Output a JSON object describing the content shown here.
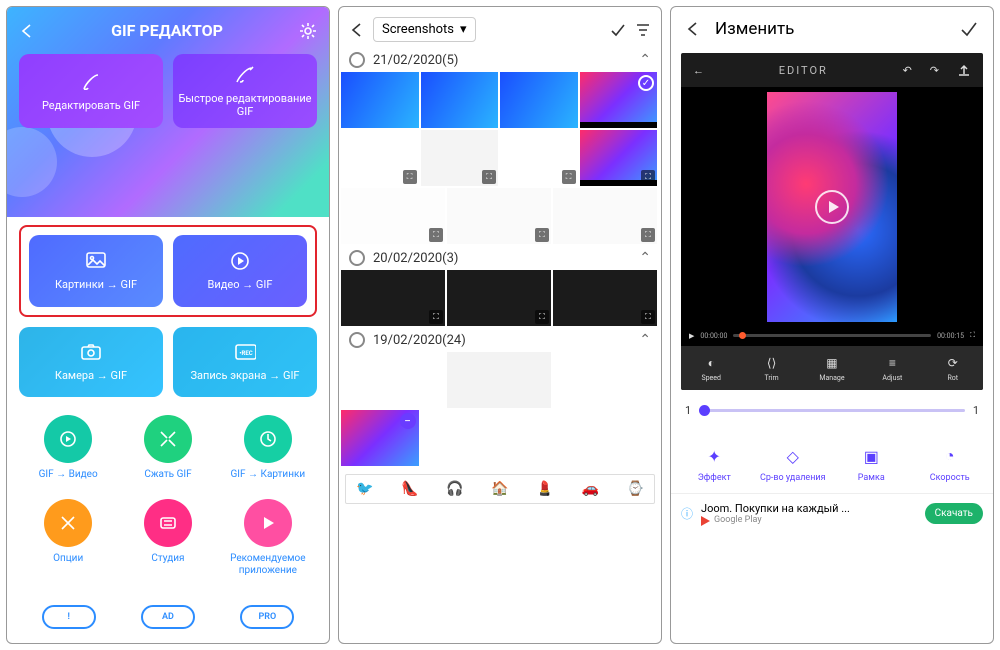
{
  "p1": {
    "title": "GIF РЕДАКТОР",
    "cards": {
      "edit": "Редактировать GIF",
      "quick": "Быстрое редактирование GIF",
      "pics": "Картинки → GIF",
      "video": "Видео → GIF",
      "camera": "Камера → GIF",
      "screen": "Запись экрана → GIF"
    },
    "grid": {
      "toVideo": "GIF → Видео",
      "compress": "Сжать GIF",
      "toPics": "GIF → Картинки",
      "options": "Опции",
      "studio": "Студия",
      "recommend": "Рекомендуемое приложение"
    },
    "pills": {
      "info": "!",
      "ad": "AD",
      "pro": "PRO"
    }
  },
  "p2": {
    "folder": "Screenshots",
    "sections": [
      {
        "label": "21/02/2020(5)"
      },
      {
        "label": "20/02/2020(3)"
      },
      {
        "label": "19/02/2020(24)"
      }
    ],
    "strip": [
      "🐦",
      "👠",
      "🎧",
      "🏠",
      "💄",
      "🚗",
      "⌚"
    ]
  },
  "p3": {
    "title": "Изменить",
    "editorLabel": "EDITOR",
    "time0": "00:00:00",
    "time1": "00:00:15",
    "tools": {
      "speed": "Speed",
      "trim": "Trim",
      "manage": "Manage",
      "adjust": "Adjust",
      "rot": "Rot"
    },
    "sliderStart": "1",
    "sliderEnd": "1",
    "actions": {
      "effect": "Эффект",
      "removal": "Ср-во удаления",
      "frame": "Рамка",
      "speed": "Скорость"
    },
    "ad": {
      "title": "Joom. Покупки на каждый ...",
      "store": "Google Play",
      "cta": "Скачать"
    }
  }
}
